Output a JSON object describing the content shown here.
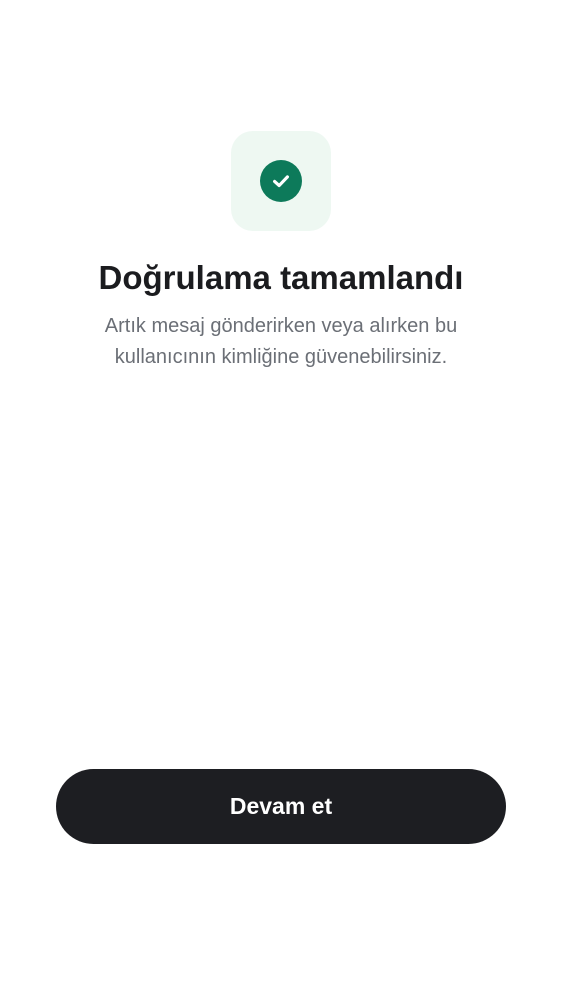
{
  "success_icon": {
    "name": "check-circle-icon",
    "tile_color": "#eef8f2",
    "circle_color": "#0d7a5a",
    "check_color": "#ffffff"
  },
  "title": "Doğrulama tamamlandı",
  "subtitle": {
    "line1": "Artık mesaj gönderirken veya alırken bu",
    "line2": "kullanıcının kimliğine güvenebilirsiniz."
  },
  "continue_button": {
    "label": "Devam et",
    "color": "#1d1e22"
  }
}
